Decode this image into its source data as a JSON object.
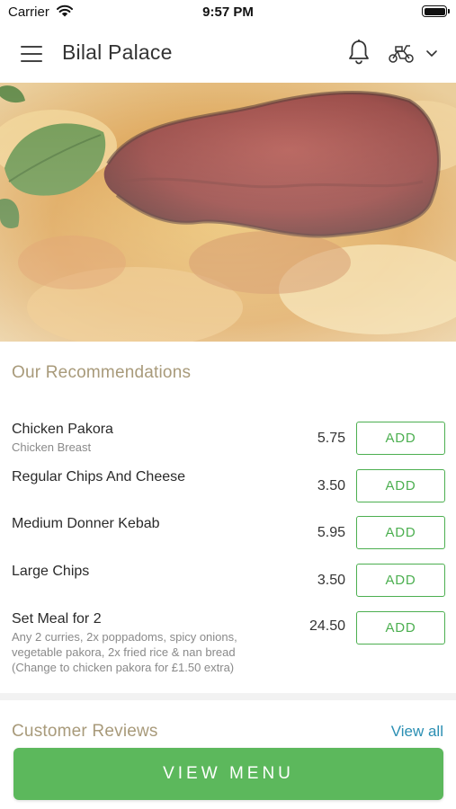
{
  "status_bar": {
    "carrier": "Carrier",
    "time": "9:57 PM"
  },
  "header": {
    "title": "Bilal Palace",
    "icons": [
      "menu-icon",
      "bell-icon",
      "scooter-icon",
      "chevron-down-icon"
    ]
  },
  "hero": {
    "image": "pizza-with-pepperoni-and-basil"
  },
  "recommendations": {
    "title": "Our Recommendations",
    "add_label": "ADD",
    "items": [
      {
        "name": "Chicken Pakora",
        "description": "Chicken Breast",
        "price": "5.75"
      },
      {
        "name": "Regular Chips And Cheese",
        "description": "",
        "price": "3.50"
      },
      {
        "name": "Medium Donner Kebab",
        "description": "",
        "price": "5.95"
      },
      {
        "name": "Large Chips",
        "description": "",
        "price": "3.50"
      },
      {
        "name": "Set Meal for 2",
        "description": "Any 2 curries, 2x poppadoms, spicy onions, vegetable pakora, 2x fried rice & nan bread (Change to chicken pakora for £1.50 extra)",
        "price": "24.50"
      }
    ]
  },
  "reviews": {
    "title": "Customer Reviews",
    "view_all": "View all"
  },
  "footer": {
    "view_menu": "VIEW MENU"
  },
  "colors": {
    "accent_green": "#5cb85c",
    "section_title": "#a89a7a",
    "link_blue": "#2b8fb3"
  }
}
